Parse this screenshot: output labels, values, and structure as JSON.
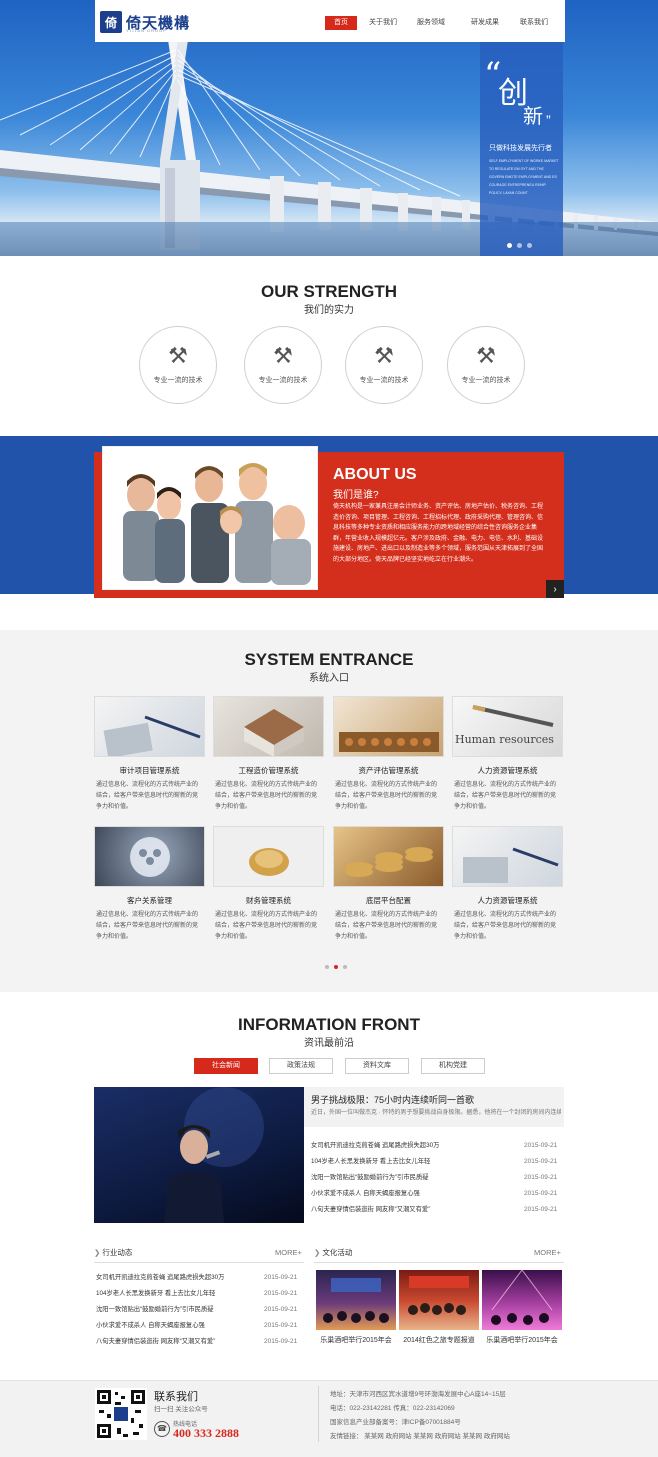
{
  "brand": {
    "logo_mark": "倚",
    "name": "倚天機構",
    "tagline": "YITIAN GROUP"
  },
  "nav": {
    "items": [
      "首页",
      "关于我们",
      "服务领域",
      "研发成果",
      "联系我们"
    ]
  },
  "hero": {
    "open_quote": "“",
    "char1": "创",
    "char2": "新",
    "close_quote": "”",
    "subtitle": "只做科技发展先行者",
    "english": "SELF EMPLOYMENT OF WORKE MARKET TO REGULATE EM OYT AND THE GOVERN EMOTE EMPLOYMENT AND ES COURAGE ENTREPRENEU RSHIP POLICY, LAYAN COUNT",
    "slide_count": 3,
    "active_slide": 0
  },
  "strength": {
    "title": "OUR STRENGTH",
    "subtitle": "我们的实力",
    "items": [
      {
        "icon": "tools-icon",
        "label": "专业一流的技术"
      },
      {
        "icon": "tools-icon",
        "label": "专业一流的技术"
      },
      {
        "icon": "tools-icon",
        "label": "专业一流的技术"
      },
      {
        "icon": "tools-icon",
        "label": "专业一流的技术"
      }
    ]
  },
  "about": {
    "title": "ABOUT US",
    "subtitle": "我们是谁?",
    "text": "倚天机构是一家兼具注册会计师业务、资产评估、房地产估价、税务咨询、工程造价咨询、项目管理、工程咨询、工程招标代理、政府采购代理、管理咨询、信息科技等多种专业资质和相应服务能力的跨地域经营的综合性咨询服务企业集群，年营业收入规模超亿元。客户涉及政府、金融、电力、电信、水利、基础设施建设、房地产、进出口以及制造业等多个领域，服务范围从天津拓展到了全国的大部分地区。倚天品牌已经坚实地屹立在行业潮头。",
    "more": "›"
  },
  "system": {
    "title": "SYSTEM ENTRANCE",
    "subtitle": "系统入口",
    "items": [
      {
        "name": "审计项目管理系统",
        "desc": "通过信息化、流程化的方式传统产业的结合，给客户带来信息时代的崭新的竞争力和价值。"
      },
      {
        "name": "工程造价管理系统",
        "desc": "通过信息化、流程化的方式传统产业的结合，给客户带来信息时代的崭新的竞争力和价值。"
      },
      {
        "name": "资产评估管理系统",
        "desc": "通过信息化、流程化的方式传统产业的结合，给客户带来信息时代的崭新的竞争力和价值。"
      },
      {
        "name": "人力资源管理系统",
        "desc": "通过信息化、流程化的方式传统产业的结合，给客户带来信息时代的崭新的竞争力和价值。",
        "img_text": "Human resources"
      },
      {
        "name": "客户关系管理",
        "desc": "通过信息化、流程化的方式传统产业的结合，给客户带来信息时代的崭新的竞争力和价值。"
      },
      {
        "name": "财务管理系统",
        "desc": "通过信息化、流程化的方式传统产业的结合，给客户带来信息时代的崭新的竞争力和价值。"
      },
      {
        "name": "底层平台配置",
        "desc": "通过信息化、流程化的方式传统产业的结合，给客户带来信息时代的崭新的竞争力和价值。"
      },
      {
        "name": "人力资源管理系统",
        "desc": "通过信息化、流程化的方式传统产业的结合，给客户带来信息时代的崭新的竞争力和价值。"
      }
    ],
    "active_page": 1
  },
  "info": {
    "title": "INFORMATION FRONT",
    "subtitle": "资讯最前沿",
    "tabs": [
      "社会新闻",
      "政策法规",
      "资料文库",
      "机构党建"
    ],
    "featured": {
      "title": "男子挑战极限：75小时内连续听同一首歌",
      "desc": "近日，外国一位叫做杰克 · 怀特的男子想要挑战自身极限。据悉，他将在一个封闭的房间内连续听同一首歌75小时……"
    },
    "news": [
      {
        "title": "女司机开凯迪拉克煎苍蝇 追尾路虎损失超30万",
        "date": "2015-09-21"
      },
      {
        "title": "104岁老人长黑发换新牙 看上去比女儿年轻",
        "date": "2015-09-21"
      },
      {
        "title": "沈阳一致馆贴出“鼓励婚前行为”引市民质疑",
        "date": "2015-09-21"
      },
      {
        "title": "小伙求爱不成杀人 自称天蝎座报复心强",
        "date": "2015-09-21"
      },
      {
        "title": "八旬夫妻穿情侣装逛街 网友称“又潮又有爱”",
        "date": "2015-09-21"
      }
    ],
    "industry": {
      "title": "行业动态",
      "more": "MORE+",
      "items": [
        {
          "title": "女司机开凯迪拉克煎苍蝇 追尾路虎损失超30万",
          "date": "2015-09-21"
        },
        {
          "title": "104岁老人长黑发换新牙 看上去比女儿年轻",
          "date": "2015-09-21"
        },
        {
          "title": "沈阳一致馆贴出“鼓励婚前行为”引市民质疑",
          "date": "2015-09-21"
        },
        {
          "title": "小伙求爱不成杀人 自称天蝎座报复心强",
          "date": "2015-09-21"
        },
        {
          "title": "八旬夫妻穿情侣装逛街 网友称“又潮又有爱”",
          "date": "2015-09-21"
        }
      ]
    },
    "culture": {
      "title": "文化活动",
      "more": "MORE+",
      "items": [
        "乐巢酒吧举行2015年会",
        "2014红色之旅专题报道",
        "乐巢酒吧举行2015年会"
      ]
    }
  },
  "footer": {
    "contact_title": "联系我们",
    "scan_text": "扫一扫  关注公众号",
    "hotline_label": "热线电话",
    "hotline": "400 333 2888",
    "address": "地址：天津市河西区宾水道增9号环渤海发展中心A座14~15层",
    "phone": "电话：022-23142281   传真：022-23142069",
    "icp": "国家信息产业部备案号：津ICP备07001884号",
    "links": "友情链接：  某某网    政府网站    某某网    政府网站    某某网    政府网站"
  },
  "colors": {
    "accent_red": "#d6291c",
    "brand_blue": "#2153ab"
  }
}
